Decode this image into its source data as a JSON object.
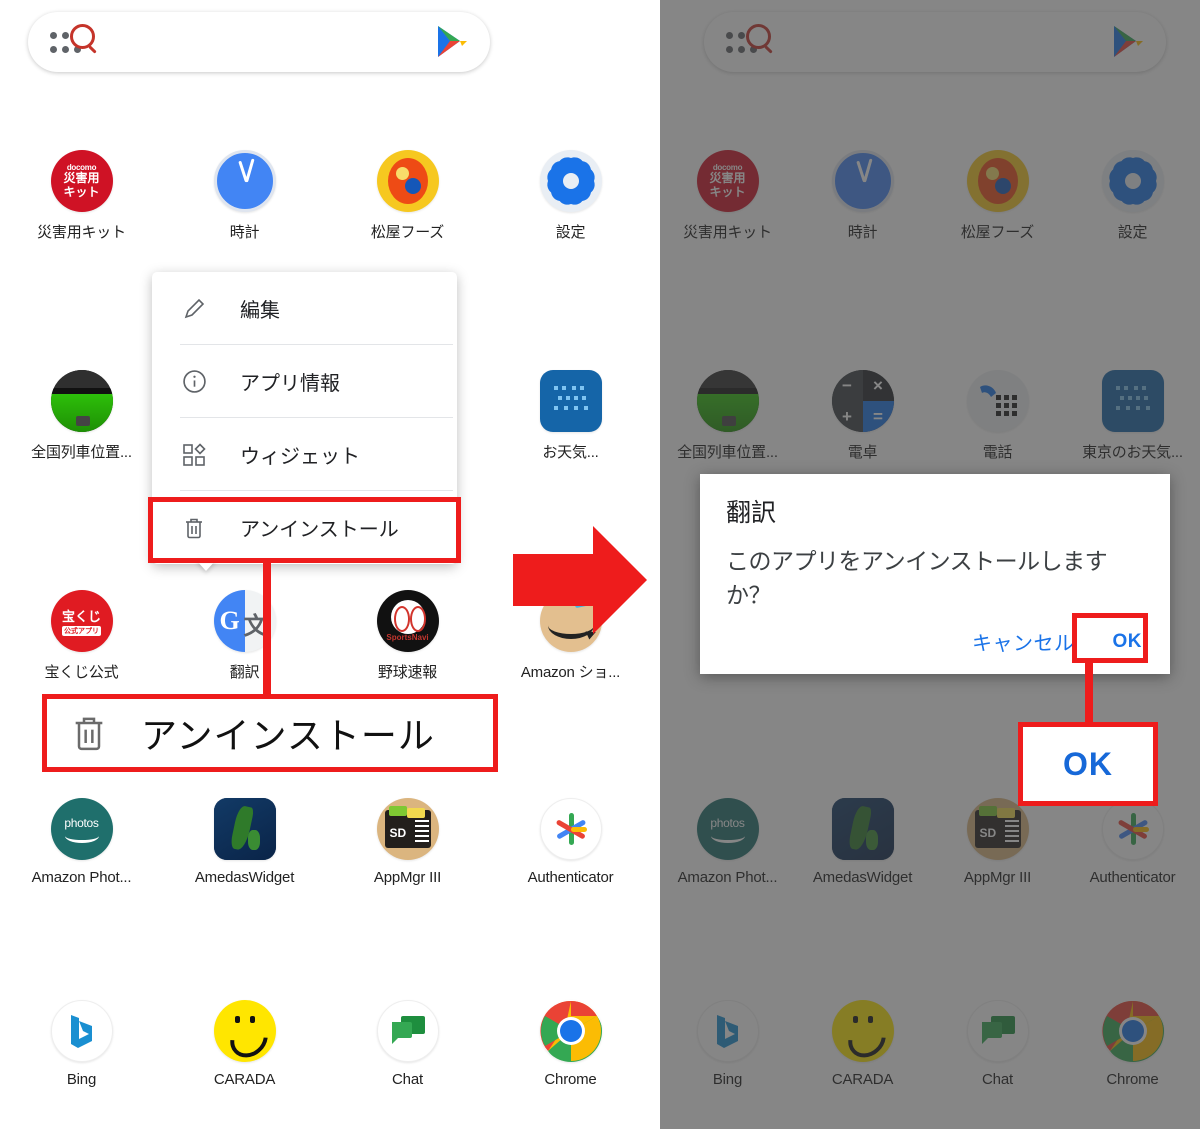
{
  "search": {
    "apps_icon": "apps-search-icon",
    "play_icon": "google-play-icon",
    "placeholder": ""
  },
  "left_panel": {
    "rows": [
      [
        {
          "label": "災害用キット",
          "icon": "docomo-disaster-kit-icon"
        },
        {
          "label": "時計",
          "icon": "clock-icon"
        },
        {
          "label": "松屋フーズ",
          "icon": "matsuya-foods-icon"
        },
        {
          "label": "設定",
          "icon": "settings-gear-icon"
        }
      ],
      [
        {
          "label": "全国列車位置...",
          "icon": "train-locator-icon"
        },
        {
          "label": "",
          "icon": "hidden-icon"
        },
        {
          "label": "",
          "icon": "hidden-icon"
        },
        {
          "label": "お天気...",
          "icon": "weather-icon"
        }
      ],
      [
        {
          "label": "宝くじ公式",
          "icon": "takarakuji-icon"
        },
        {
          "label": "翻訳",
          "icon": "google-translate-icon"
        },
        {
          "label": "野球速報",
          "icon": "baseball-news-icon"
        },
        {
          "label": "Amazon ショ...",
          "icon": "amazon-shopping-icon"
        }
      ],
      [
        {
          "label": "Amazon Phot...",
          "icon": "amazon-photos-icon"
        },
        {
          "label": "AmedasWidget",
          "icon": "amedas-widget-icon"
        },
        {
          "label": "AppMgr III",
          "icon": "appmgr-icon"
        },
        {
          "label": "Authenticator",
          "icon": "authenticator-icon"
        }
      ],
      [
        {
          "label": "Bing",
          "icon": "bing-icon"
        },
        {
          "label": "CARADA",
          "icon": "carada-icon"
        },
        {
          "label": "Chat",
          "icon": "google-chat-icon"
        },
        {
          "label": "Chrome",
          "icon": "chrome-icon"
        }
      ]
    ]
  },
  "context_menu": {
    "items": [
      {
        "label": "編集",
        "icon": "pencil-edit-icon"
      },
      {
        "label": "アプリ情報",
        "icon": "info-circle-icon"
      },
      {
        "label": "ウィジェット",
        "icon": "widget-icon"
      },
      {
        "label": "アンインストール",
        "icon": "trash-icon"
      }
    ]
  },
  "right_panel": {
    "rows": [
      [
        {
          "label": "災害用キット",
          "icon": "docomo-disaster-kit-icon"
        },
        {
          "label": "時計",
          "icon": "clock-icon"
        },
        {
          "label": "松屋フーズ",
          "icon": "matsuya-foods-icon"
        },
        {
          "label": "設定",
          "icon": "settings-gear-icon"
        }
      ],
      [
        {
          "label": "全国列車位置...",
          "icon": "train-locator-icon"
        },
        {
          "label": "電卓",
          "icon": "calculator-icon"
        },
        {
          "label": "電話",
          "icon": "phone-icon"
        },
        {
          "label": "東京のお天気...",
          "icon": "tokyo-weather-icon"
        }
      ],
      [
        {
          "label": "Amazon Phot...",
          "icon": "amazon-photos-icon"
        },
        {
          "label": "AmedasWidget",
          "icon": "amedas-widget-icon"
        },
        {
          "label": "AppMgr III",
          "icon": "appmgr-icon"
        },
        {
          "label": "Authenticator",
          "icon": "authenticator-icon"
        }
      ],
      [
        {
          "label": "Bing",
          "icon": "bing-icon"
        },
        {
          "label": "CARADA",
          "icon": "carada-icon"
        },
        {
          "label": "Chat",
          "icon": "google-chat-icon"
        },
        {
          "label": "Chrome",
          "icon": "chrome-icon"
        }
      ]
    ]
  },
  "dialog": {
    "title": "翻訳",
    "message": "このアプリをアンインストールしますか？",
    "cancel_label": "キャンセル",
    "ok_label": "OK"
  },
  "annotations": {
    "callout_uninstall": "アンインストール",
    "callout_ok": "OK",
    "arrow": "red-right-arrow",
    "highlight_color": "#ee1c1c"
  }
}
